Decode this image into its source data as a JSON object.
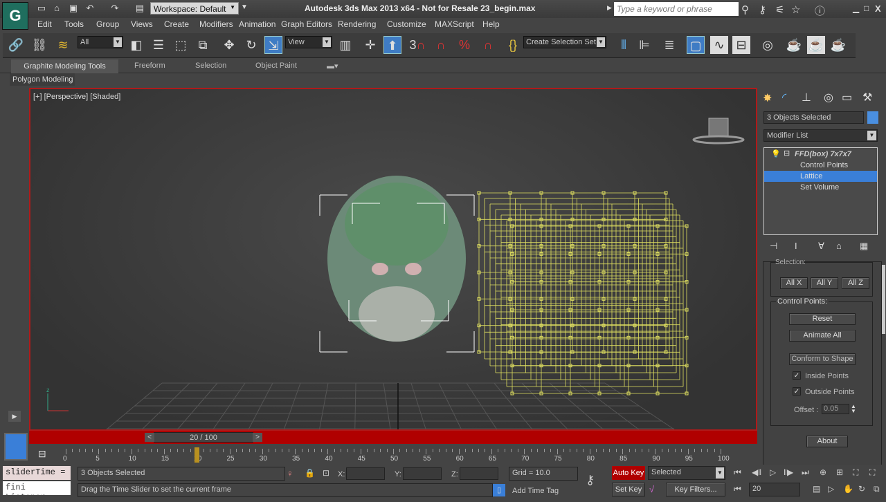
{
  "app": {
    "title": "Autodesk 3ds Max  2013 x64  - Not for Resale   23_begin.max",
    "workspace": "Workspace: Default",
    "search_placeholder": "Type a keyword or phrase"
  },
  "menu": [
    "Edit",
    "Tools",
    "Group",
    "Views",
    "Create",
    "Modifiers",
    "Animation",
    "Graph Editors",
    "Rendering",
    "Customize",
    "MAXScript",
    "Help"
  ],
  "toolbar": {
    "filter": "All",
    "refcoord": "View",
    "snap_label": "3",
    "selection_set": "Create Selection Set"
  },
  "ribbon": {
    "tabs": [
      "Graphite Modeling Tools",
      "Freeform",
      "Selection",
      "Object Paint"
    ],
    "panel": "Polygon Modeling"
  },
  "viewport": {
    "label": "[+] [Perspective] [Shaded]",
    "axis": "z"
  },
  "timeline": {
    "slider": "20 / 100",
    "current": 20,
    "max": 100,
    "ticks": [
      "0",
      "5",
      "10",
      "15",
      "20",
      "25",
      "30",
      "35",
      "40",
      "45",
      "50",
      "55",
      "60",
      "65",
      "70",
      "75",
      "80",
      "85",
      "90",
      "95",
      "100"
    ],
    "prev": "<",
    "next": ">"
  },
  "command_panel": {
    "selection": "3 Objects Selected",
    "modifier_list": "Modifier List",
    "stack": {
      "modifier": "FFD(box) 7x7x7",
      "items": [
        "Control Points",
        "Lattice",
        "Set Volume"
      ],
      "selected": "Lattice"
    },
    "selection_group": "Selection:",
    "all_x": "All X",
    "all_y": "All Y",
    "all_z": "All Z",
    "control_points": "Control Points:",
    "reset": "Reset",
    "animate_all": "Animate All",
    "conform": "Conform to Shape",
    "inside_points": "Inside Points",
    "outside_points": "Outside Points",
    "offset_label": "Offset :",
    "offset": "0.05",
    "about": "About"
  },
  "status": {
    "maxscript": "sliderTime =",
    "listener": "fini Listener",
    "selected": "3 Objects Selected",
    "prompt": "Drag the Time Slider to set the current frame",
    "x_label": "X:",
    "y_label": "Y:",
    "z_label": "Z:",
    "grid": "Grid = 10.0",
    "add_time_tag": "Add Time Tag",
    "auto_key": "Auto Key",
    "set_key": "Set Key",
    "key_mode": "Selected",
    "key_filters": "Key Filters...",
    "frame": "20"
  },
  "colors": {
    "accent": "#3a7fd8",
    "viewport_border": "#b01a1a",
    "lattice": "#e0e060",
    "auto_key": "#b00000"
  }
}
